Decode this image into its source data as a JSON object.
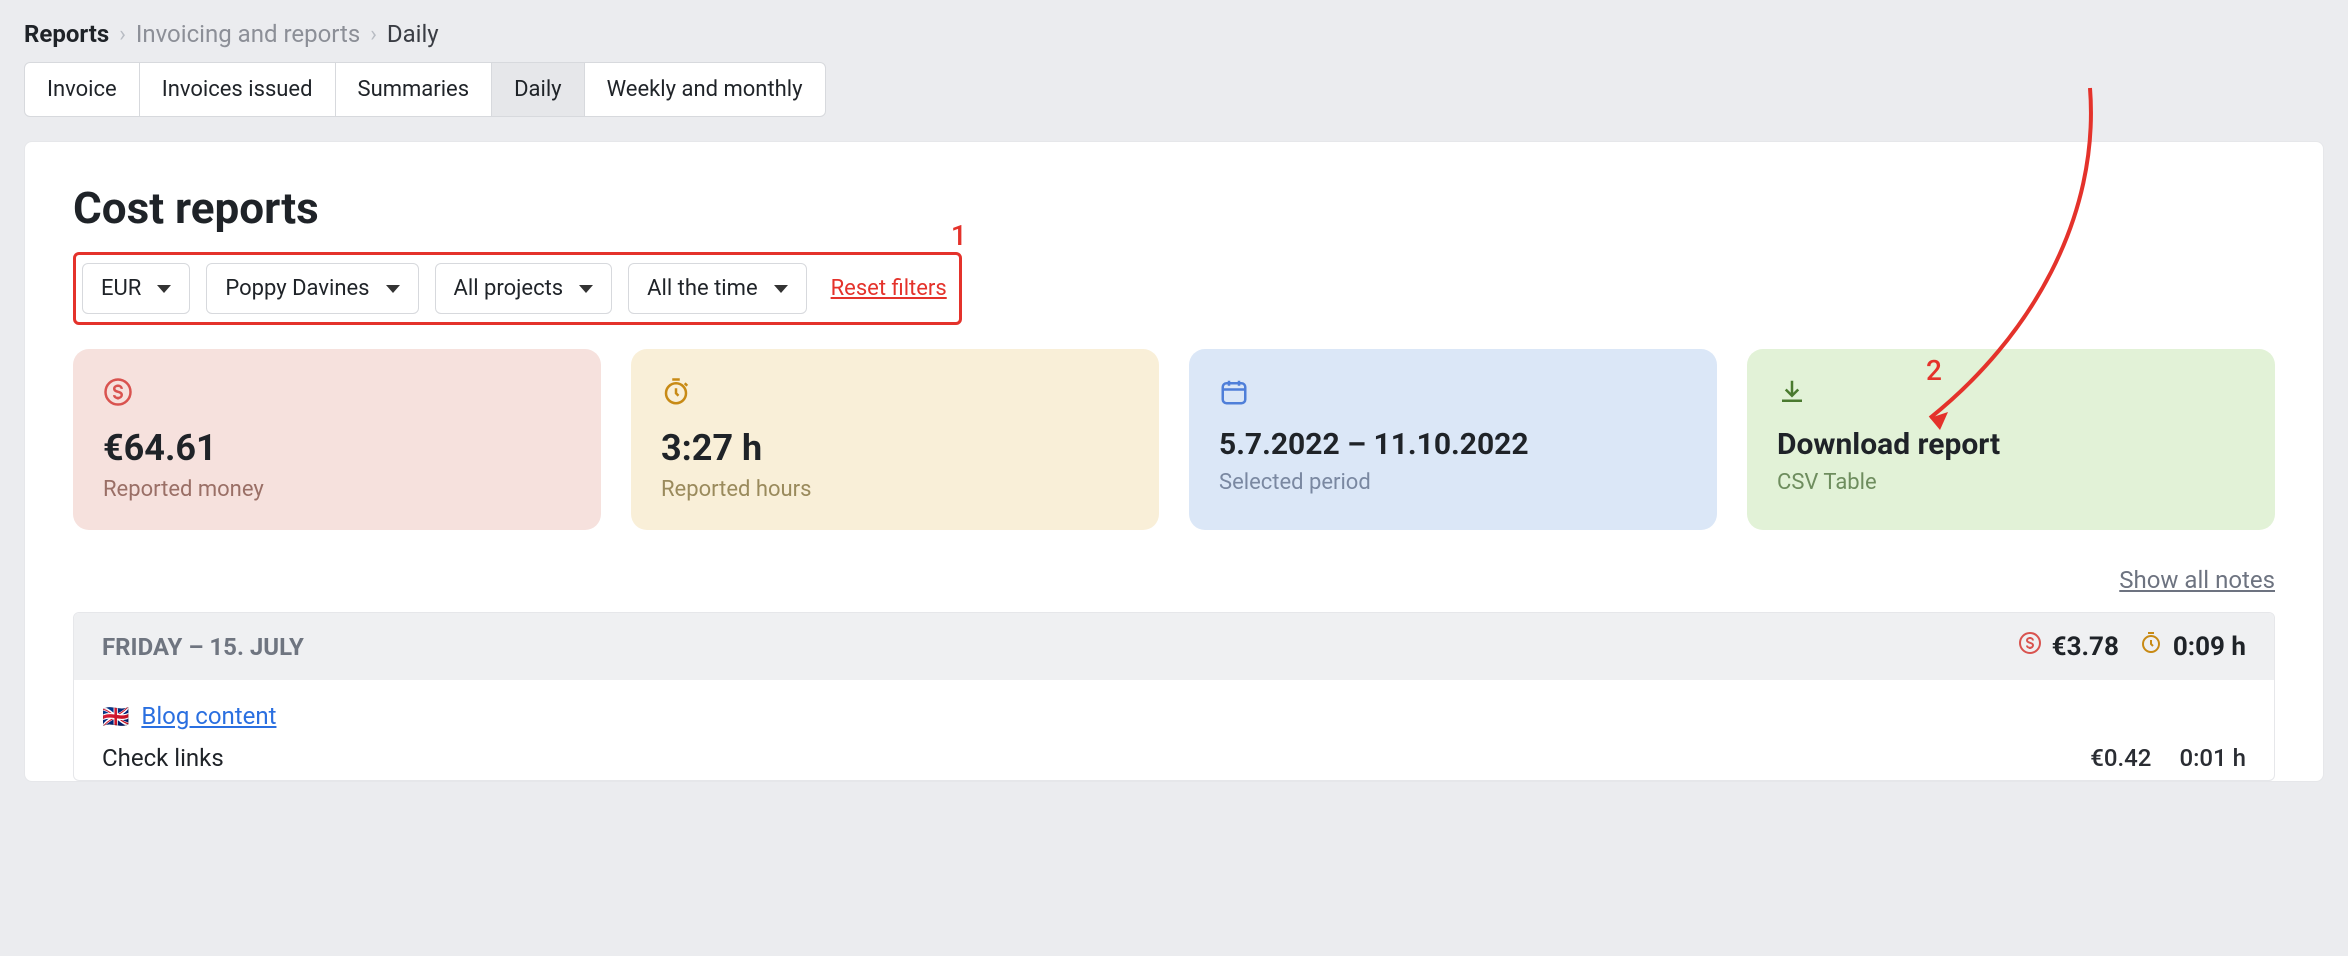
{
  "breadcrumb": {
    "root": "Reports",
    "mid": "Invoicing and reports",
    "leaf": "Daily"
  },
  "tabs": {
    "invoice": "Invoice",
    "issued": "Invoices issued",
    "summaries": "Summaries",
    "daily": "Daily",
    "weekly": "Weekly and monthly"
  },
  "page": {
    "title": "Cost reports"
  },
  "filters": {
    "currency": "EUR",
    "person": "Poppy Davines",
    "project": "All projects",
    "period": "All the time",
    "reset": "Reset filters"
  },
  "annotations": {
    "one": "1",
    "two": "2"
  },
  "cards": {
    "money": {
      "value": "€64.61",
      "label": "Reported money"
    },
    "hours": {
      "value": "3:27 h",
      "label": "Reported hours"
    },
    "period": {
      "value": "5.7.2022 – 11.10.2022",
      "label": "Selected period"
    },
    "download": {
      "title": "Download report",
      "sub": "CSV Table"
    }
  },
  "notes": {
    "show_all": "Show all notes"
  },
  "day": {
    "title": "FRIDAY – 15. JULY",
    "amount": "€3.78",
    "time": "0:09 h",
    "project": "Blog content",
    "flag": "🇬🇧",
    "task": "Check links",
    "task_amount": "€0.42",
    "task_time": "0:01 h"
  }
}
